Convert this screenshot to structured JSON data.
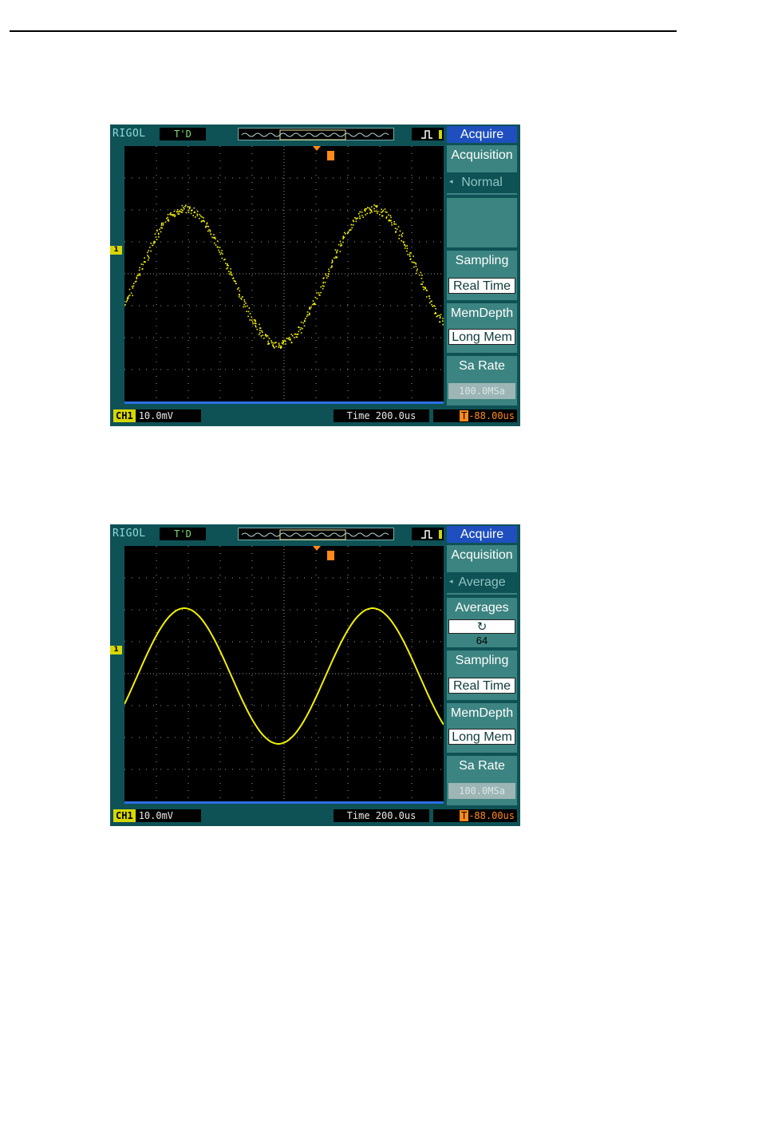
{
  "screenshots": [
    {
      "brand": "RIGOL",
      "status": "T'D",
      "menu": {
        "title": "Acquire",
        "items": [
          {
            "label": "Acquisition",
            "value": "Normal"
          },
          {
            "label": "",
            "value": ""
          },
          {
            "label": "Sampling",
            "value": "Real Time"
          },
          {
            "label": "MemDepth",
            "value": "Long Mem"
          },
          {
            "label": "Sa Rate",
            "value": "100.0MSa"
          }
        ]
      },
      "channel": {
        "badge": "CH1",
        "scale": "10.0mV"
      },
      "timebase": "Time 200.0us",
      "trigger_offset": "-88.00us",
      "waveform": "noisy-sine"
    },
    {
      "brand": "RIGOL",
      "status": "T'D",
      "menu": {
        "title": "Acquire",
        "items": [
          {
            "label": "Acquisition",
            "value": "Average"
          },
          {
            "label": "Averages",
            "value": "64"
          },
          {
            "label": "Sampling",
            "value": "Real Time"
          },
          {
            "label": "MemDepth",
            "value": "Long Mem"
          },
          {
            "label": "Sa Rate",
            "value": "100.0MSa"
          }
        ]
      },
      "channel": {
        "badge": "CH1",
        "scale": "10.0mV"
      },
      "timebase": "Time 200.0us",
      "trigger_offset": "-88.00us",
      "waveform": "clean-sine"
    }
  ],
  "colors": {
    "frame": "#0e5255",
    "trace": "#f2f200",
    "menu_title": "#1f4fbf",
    "trigger": "#ff8a1a"
  }
}
